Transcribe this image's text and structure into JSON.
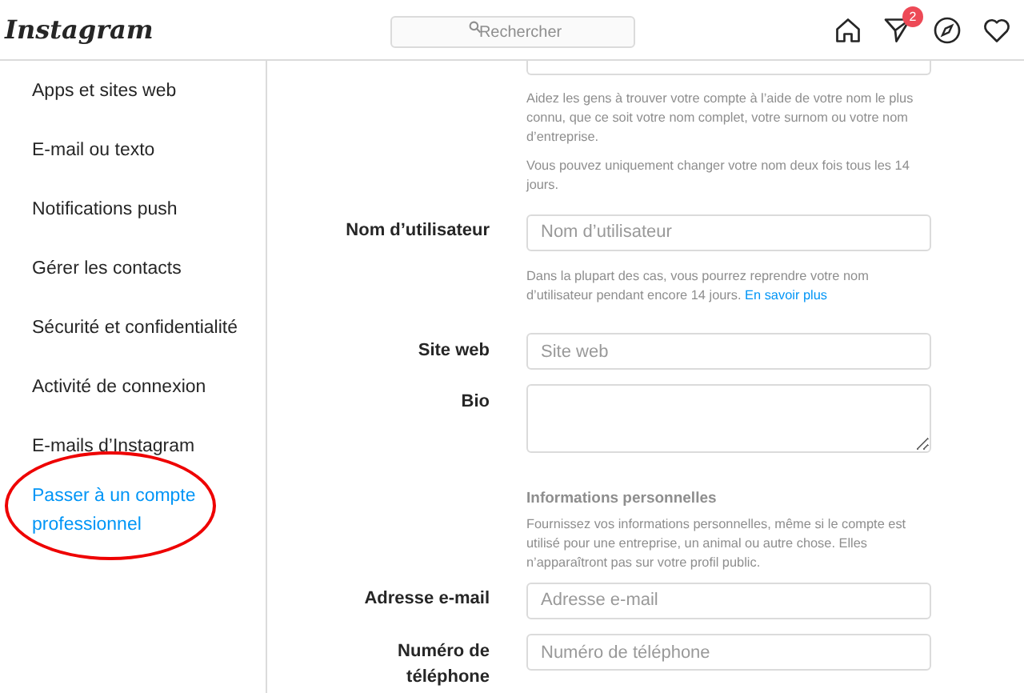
{
  "header": {
    "logo": "Instagram",
    "search": {
      "placeholder": "Rechercher"
    },
    "notifications_badge": "2"
  },
  "sidebar": {
    "items": [
      {
        "label": "Apps et sites web",
        "kind": "item"
      },
      {
        "label": "E-mail ou texto",
        "kind": "item"
      },
      {
        "label": "Notifications push",
        "kind": "item"
      },
      {
        "label": "Gérer les contacts",
        "kind": "item"
      },
      {
        "label": "Sécurité et confidentialité",
        "kind": "item"
      },
      {
        "label": "Activité de connexion",
        "kind": "item"
      },
      {
        "label": "E-mails d’Instagram",
        "kind": "item"
      },
      {
        "label": "Passer à un compte professionnel",
        "kind": "link",
        "circled": true
      }
    ]
  },
  "form": {
    "name_help": [
      "Aidez les gens à trouver votre compte à l’aide de votre nom le plus connu, que ce soit votre nom complet, votre surnom ou votre nom d’entreprise.",
      "Vous pouvez uniquement changer votre nom deux fois tous les 14 jours."
    ],
    "fields": [
      {
        "kind": "input",
        "label": "Nom d’utilisateur",
        "placeholder": "Nom d’utilisateur",
        "help": "Dans la plupart des cas, vous pourrez reprendre votre nom d’utilisateur pendant encore 14 jours.",
        "help_link": "En savoir plus"
      },
      {
        "kind": "input",
        "label": "Site web",
        "placeholder": "Site web"
      },
      {
        "kind": "textarea",
        "label": "Bio"
      },
      {
        "kind": "section",
        "title": "Informations personnelles",
        "text": "Fournissez vos informations personnelles, même si le compte est utilisé pour une entreprise, un animal ou autre chose. Elles n’apparaîtront pas sur votre profil public."
      },
      {
        "kind": "input",
        "label": "Adresse e-mail",
        "placeholder": "Adresse e-mail"
      },
      {
        "kind": "input",
        "label": "Numéro de téléphone",
        "placeholder": "Numéro de téléphone"
      }
    ]
  }
}
